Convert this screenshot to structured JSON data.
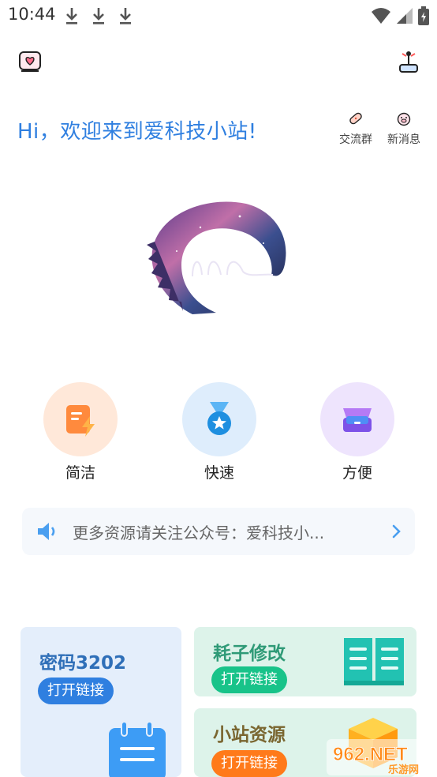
{
  "status_bar": {
    "time": "10:44",
    "icons": [
      "download-icon",
      "download-icon",
      "download-icon",
      "wifi-icon",
      "signal-icon",
      "battery-icon"
    ]
  },
  "header": {
    "left_icon": "notebook-heart-icon",
    "right_icon": "joystick-icon"
  },
  "greeting": "Hi，欢迎来到爱科技小站!",
  "quick_actions": [
    {
      "label": "交流群",
      "icon": "bandage-icon"
    },
    {
      "label": "新消息",
      "icon": "pig-face-icon"
    }
  ],
  "features": [
    {
      "label": "简洁",
      "icon": "document-bolt-icon",
      "color": "#ff8a3d"
    },
    {
      "label": "快速",
      "icon": "medal-star-icon",
      "color": "#1e8fe0"
    },
    {
      "label": "方便",
      "icon": "inbox-box-icon",
      "color": "#8a5cf0"
    }
  ],
  "notice": {
    "text": "更多资源请关注公众号：爱科技小...",
    "icon": "speaker-icon"
  },
  "cards": [
    {
      "title": "密码3202",
      "button": "打开链接",
      "icon": "notepad-icon",
      "accent": "#2f7fe0"
    },
    {
      "title": "耗子修改",
      "button": "打开链接",
      "icon": "open-book-icon",
      "accent": "#18c389"
    },
    {
      "title": "小站资源",
      "button": "打开链接",
      "icon": "package-box-icon",
      "accent": "#ff7a1a"
    }
  ],
  "watermark": {
    "text": "962.NET",
    "subtext": "乐游网"
  }
}
